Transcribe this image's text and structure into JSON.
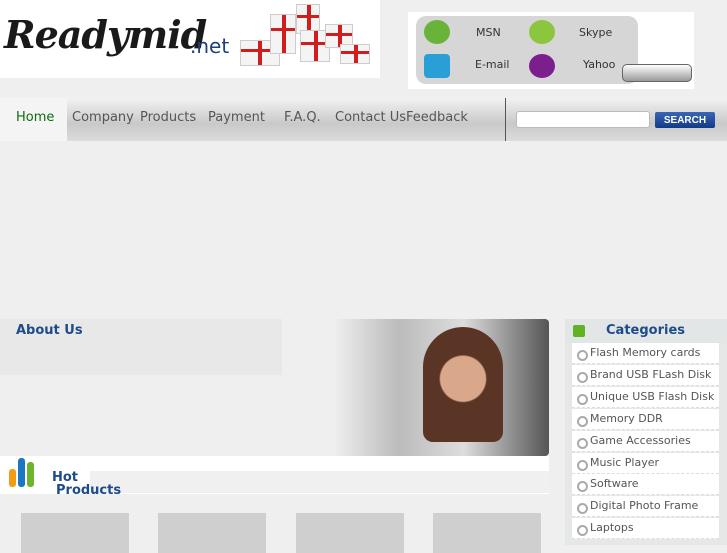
{
  "logo": {
    "brand": "Readymid",
    "tld": ".net"
  },
  "contact": [
    {
      "label": "MSN",
      "icon": "msn-icon"
    },
    {
      "label": "Skype",
      "icon": "skype-icon"
    },
    {
      "label": "E-mail",
      "icon": "email-icon"
    },
    {
      "label": "Yahoo",
      "icon": "yahoo-icon"
    }
  ],
  "nav": [
    "Home",
    "Company",
    "Products",
    "Payment",
    "F.A.Q.",
    "Contact Us",
    "Feedback"
  ],
  "search": {
    "value": "",
    "button": "SEARCH"
  },
  "about": {
    "title": "About Us"
  },
  "hot": {
    "line1": "Hot",
    "line2": "Products"
  },
  "categories": {
    "title": "Categories",
    "items": [
      "Flash Memory cards",
      "Brand USB FLash Disk",
      "Unique USB Flash Disk",
      "Memory DDR",
      "Game Accessories",
      "Music Player",
      "Software",
      "Digital Photo Frame",
      "Laptops"
    ]
  },
  "colors": {
    "nav_active": "#0f6b0f",
    "heading": "#1e4b8a",
    "search_btn": "#1a4596"
  }
}
